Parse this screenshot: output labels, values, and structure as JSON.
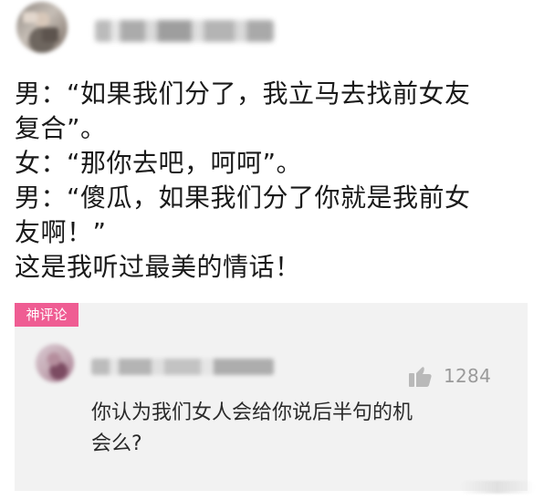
{
  "post": {
    "username": "",
    "body_lines": [
      "男：“如果我们分了，我立马去找前女友",
      "复合”。",
      "女：“那你去吧，呵呵”。",
      "男：“傻瓜，如果我们分了你就是我前女",
      "友啊！”",
      "这是我听过最美的情话！"
    ]
  },
  "comment": {
    "badge": "神评论",
    "username": "",
    "like_count": "1284",
    "text_lines": [
      "你认为我们女人会给你说后半句的机",
      "会么?"
    ]
  },
  "icons": {
    "post_avatar": "avatar-icon",
    "comment_avatar": "avatar-icon",
    "like": "thumbs-up-icon"
  },
  "colors": {
    "badge": "#ef5d93",
    "comment_background": "#f2f2f2",
    "like_icon": "#b9b9b9",
    "like_count": "#9a9a9a"
  }
}
